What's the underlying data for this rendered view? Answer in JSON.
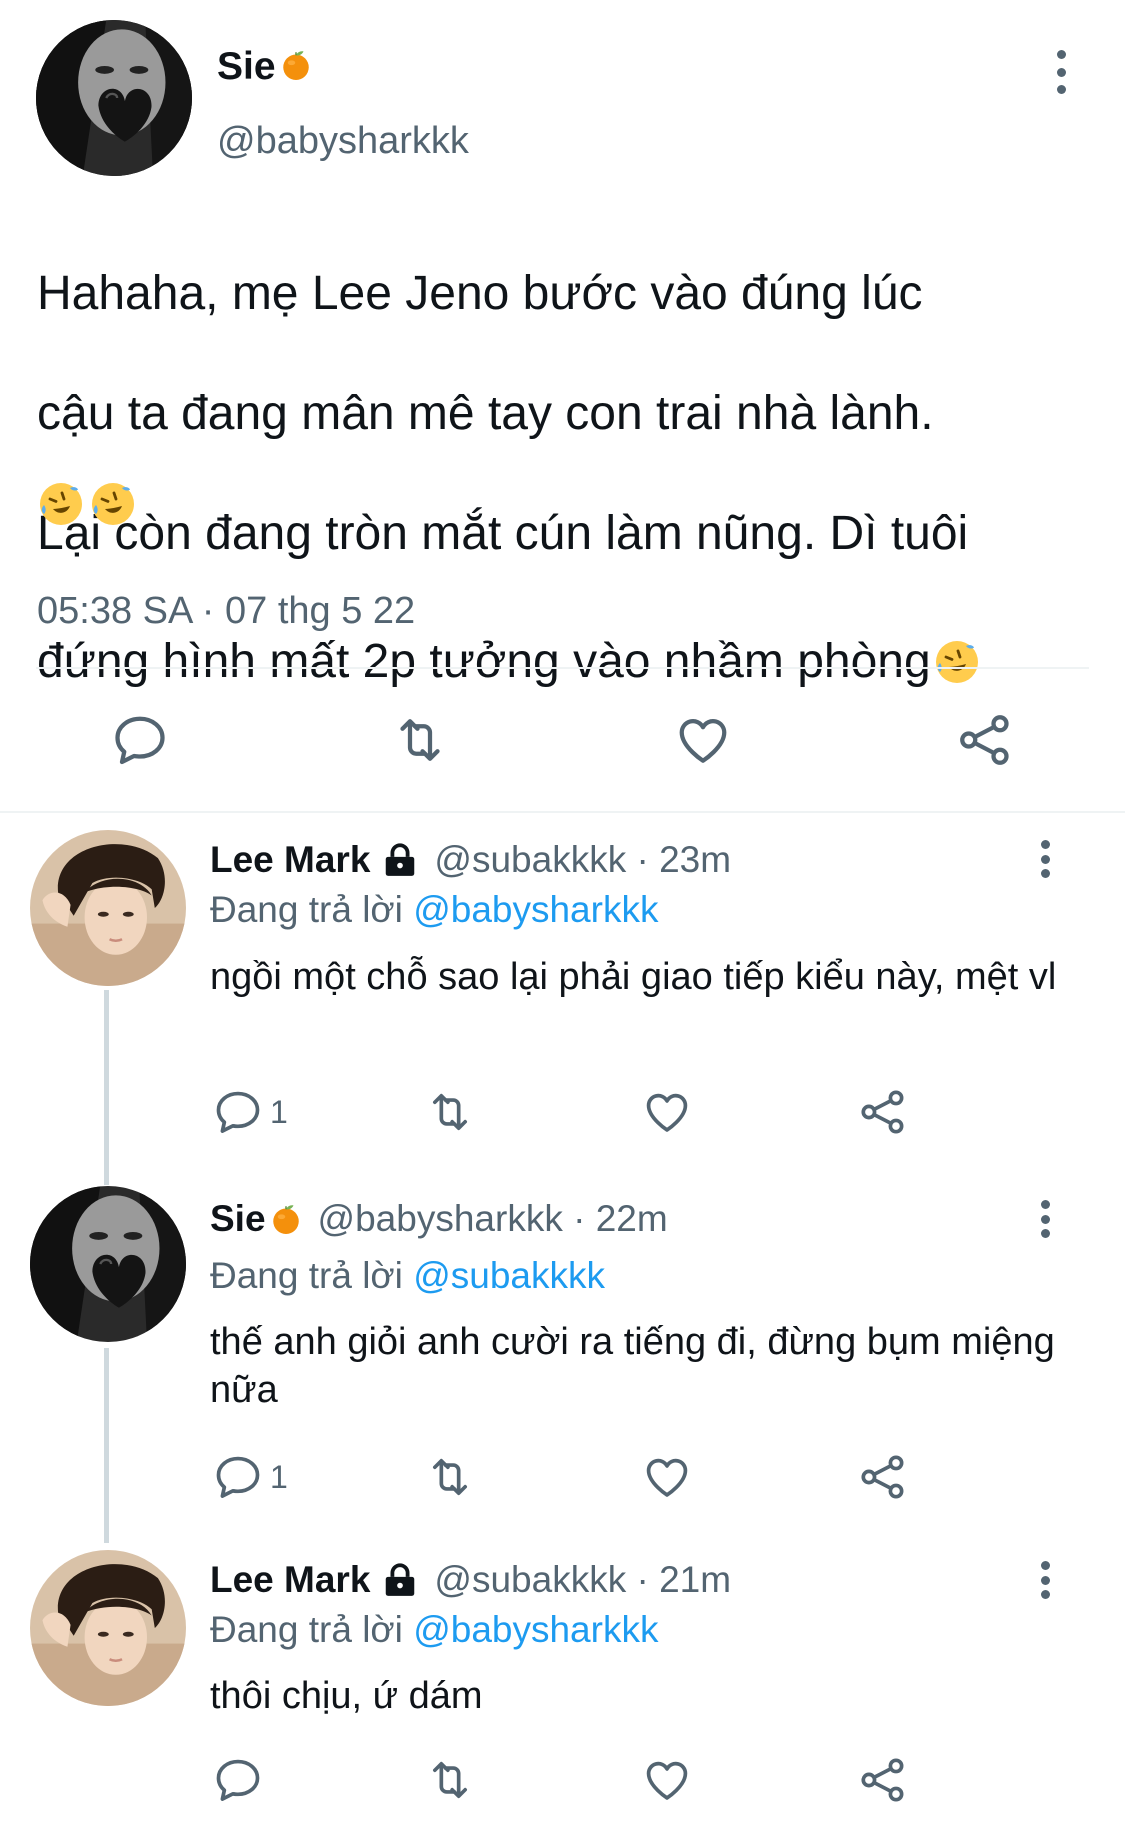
{
  "main_tweet": {
    "name": "Sie",
    "name_emoji": "orange-emoji",
    "handle": "@babysharkkk",
    "text_lines": [
      "Hahaha, mẹ Lee Jeno bước vào đúng lúc",
      "cậu ta đang mân mê tay con trai nhà lành.",
      "Lại còn đang tròn mắt cún làm nũng. Dì tuôi",
      "đứng hình mất 2p tưởng vào nhầm phòng"
    ],
    "trailing_emoji": "rofl-emoji",
    "emoji_line": [
      "rofl-emoji",
      "rofl-emoji"
    ],
    "timestamp": "05:38 SA · 07 thg 5 22",
    "actions": [
      "reply-icon",
      "retweet-icon",
      "like-icon",
      "share-icon"
    ]
  },
  "replies": [
    {
      "name": "Lee Mark",
      "locked": true,
      "handle_time": "@subakkkk · 23m",
      "replying_prefix": "Đang trả lời",
      "replying_to": "@babysharkkk",
      "text": "ngồi một chỗ sao lại phải giao tiếp kiểu này, mệt vl",
      "reply_count": "1"
    },
    {
      "name": "Sie",
      "name_emoji": "orange-emoji",
      "handle_time": "@babysharkkk · 22m",
      "replying_prefix": "Đang trả lời",
      "replying_to": "@subakkkk",
      "text": "thế anh giỏi anh cười ra tiếng đi, đừng bụm miệng nữa",
      "reply_count": "1"
    },
    {
      "name": "Lee Mark",
      "locked": true,
      "handle_time": "@subakkkk · 21m",
      "replying_prefix": "Đang trả lời",
      "replying_to": "@babysharkkk",
      "text": "thôi chịu, ứ dám",
      "reply_count": ""
    }
  ],
  "colors": {
    "text": "#0f1419",
    "secondary": "#536471",
    "link": "#1d9bf0",
    "divider": "#eff3f4",
    "thread_line": "#cfd9de"
  }
}
